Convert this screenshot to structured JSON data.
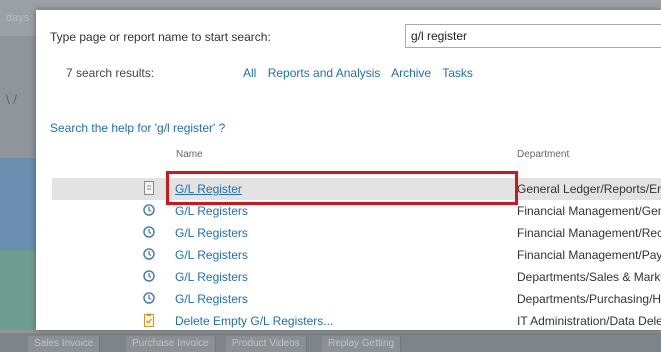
{
  "background": {
    "top_label": "days",
    "side_glyph": "\\ /",
    "tabs": [
      "Sales Invoice",
      "Purchase Invoice",
      "Product Videos",
      "Replay Getting"
    ]
  },
  "dialog": {
    "prompt": "Type page or report name to start search:",
    "search_value": "g/l register",
    "result_count": "7 search results:",
    "filters": [
      "All",
      "Reports and Analysis",
      "Archive",
      "Tasks"
    ],
    "help_link": "Search the help for 'g/l register' ?",
    "columns": {
      "name": "Name",
      "department": "Department"
    },
    "results": [
      {
        "icon": "report-page-icon",
        "name": "G/L Register",
        "department": "General Ledger/Reports/Ent",
        "selected": true
      },
      {
        "icon": "history-icon",
        "name": "G/L Registers",
        "department": "Financial Management/Gen"
      },
      {
        "icon": "history-icon",
        "name": "G/L Registers",
        "department": "Financial Management/Rece"
      },
      {
        "icon": "history-icon",
        "name": "G/L Registers",
        "department": "Financial Management/Paya"
      },
      {
        "icon": "history-icon",
        "name": "G/L Registers",
        "department": "Departments/Sales & Marke"
      },
      {
        "icon": "history-icon",
        "name": "G/L Registers",
        "department": "Departments/Purchasing/Hi"
      },
      {
        "icon": "task-clipboard-icon",
        "name": "Delete Empty G/L Registers...",
        "department": "IT Administration/Data Dele"
      }
    ],
    "highlight_color": "#d0161c",
    "link_color": "#1f6fb5"
  }
}
